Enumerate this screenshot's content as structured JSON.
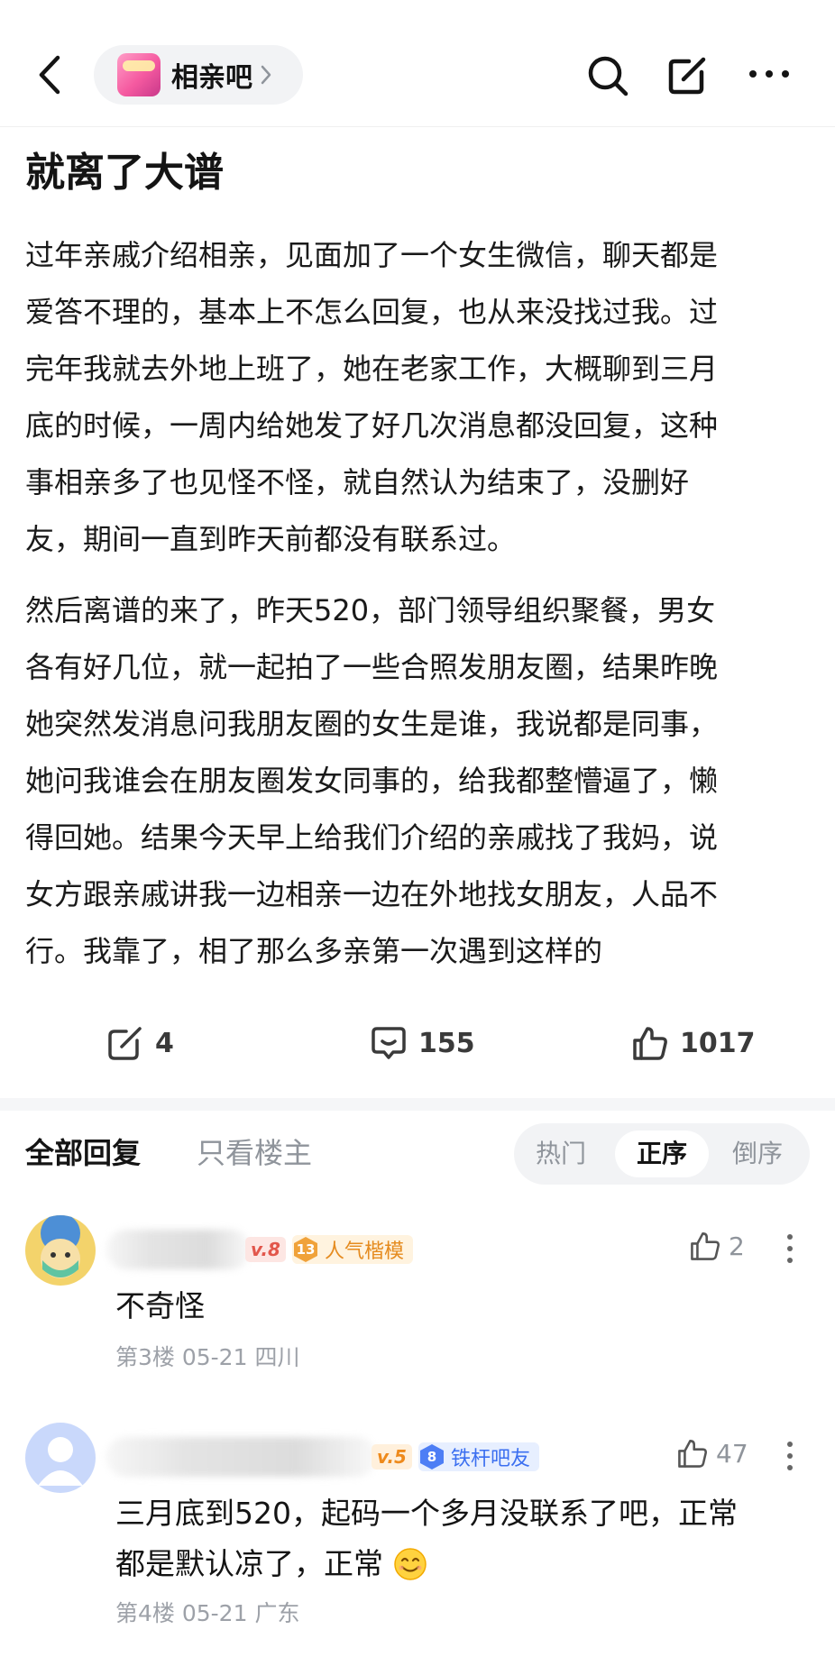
{
  "header": {
    "forum_name": "相亲吧",
    "forum_logo_text": "相亲吧",
    "icons": [
      "back-arrow-icon",
      "search-icon",
      "edit-icon",
      "more-icon"
    ]
  },
  "post": {
    "title": "就离了大谱",
    "paragraph1": [
      "过年亲戚介绍相亲，见面加了一个女生微信，聊天都是",
      "爱答不理的，基本上不怎么回复，也从来没找过我。过",
      "完年我就去外地上班了，她在老家工作，大概聊到三月",
      "底的时候，一周内给她发了好几次消息都没回复，这种",
      "事相亲多了也见怪不怪，就自然认为结束了，没删好",
      "友，期间一直到昨天前都没有联系过。"
    ],
    "paragraph2": [
      "然后离谱的来了，昨天520，部门领导组织聚餐，男女",
      "各有好几位，就一起拍了一些合照发朋友圈，结果昨晚",
      "她突然发消息问我朋友圈的女生是谁，我说都是同事，",
      "她问我谁会在朋友圈发女同事的，给我都整懵逼了，懒",
      "得回她。结果今天早上给我们介绍的亲戚找了我妈，说",
      "女方跟亲戚讲我一边相亲一边在外地找女朋友，人品不",
      "行。我靠了，相了那么多亲第一次遇到这样的"
    ],
    "actions": {
      "share_count": "4",
      "comment_count": "155",
      "like_count": "1017"
    }
  },
  "replies": {
    "tab_all": "全部回复",
    "tab_op_only": "只看楼主",
    "sort_options": [
      "热门",
      "正序",
      "倒序"
    ],
    "sort_selected": "正序",
    "items": [
      {
        "level": "Lv.8",
        "level_visible": "v.8",
        "honor_number": "13",
        "honor_title": "人气楷模",
        "like_count": "2",
        "text_lines": [
          "不奇怪"
        ],
        "meta": "第3楼 05-21 四川"
      },
      {
        "level": "Lv.5",
        "level_visible": "v.5",
        "honor_number": "8",
        "honor_title": "铁杆吧友",
        "like_count": "47",
        "text_lines": [
          "三月底到520，起码一个多月没联系了吧，正常",
          "都是默认凉了，正常"
        ],
        "emoji": "smiling-face-emoji",
        "meta": "第4楼 05-21 广东"
      }
    ]
  },
  "colors": {
    "accent_orange": "#e58b1f",
    "accent_blue": "#3b6ff0",
    "muted_text": "#9da1a8"
  }
}
